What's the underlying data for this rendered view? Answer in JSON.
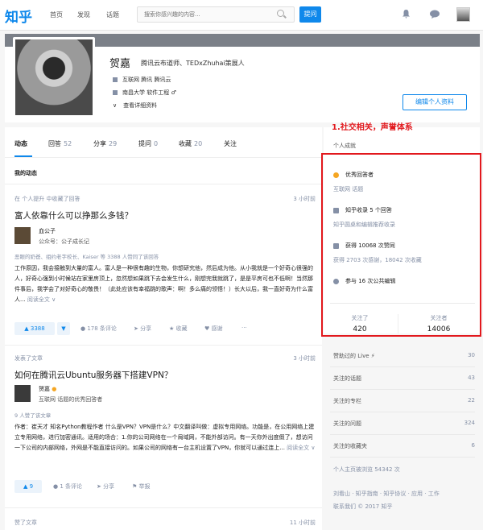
{
  "topbar": {
    "logo": "知乎",
    "nav": [
      "首页",
      "发现",
      "话题"
    ],
    "search_placeholder": "搜索你感兴趣的内容...",
    "ask_label": "提问"
  },
  "profile": {
    "name": "贺嘉",
    "headline": "腾讯云布道师、TEDxZhuhai策展人",
    "industry": "互联网 腾讯 腾讯云",
    "education": "南昌大学 软件工程 ♂",
    "more": "查看详细资料",
    "edit_label": "编辑个人资料"
  },
  "tabs": [
    {
      "label": "动态",
      "count": ""
    },
    {
      "label": "回答",
      "count": "52"
    },
    {
      "label": "分享",
      "count": "29"
    },
    {
      "label": "提问",
      "count": "0"
    },
    {
      "label": "收藏",
      "count": "20"
    },
    {
      "label": "关注",
      "count": ""
    }
  ],
  "feed": {
    "section_title": "我的动态",
    "item1": {
      "meta": "在 个人提升 中收藏了回答",
      "time": "3 小时前",
      "title": "富人依靠什么可以挣那么多钱？",
      "author": "血公子",
      "bio": "公众号：公子成长记",
      "voters": "恶眼的奶爸、组约老字校长、Kaiser 等 3388 人赞同了该回答",
      "body": "工作原因，我会接触到大量的富人。富人是一种很有趣的生物，你想研究他，然后成为他。从小我就是一个好奇心很强的人，好奇心强到小时候站在家里房顶上，忽然想如果跳下去会发生什么，刚想完我就跳了，是是平房可也不低啊！当然那件事后，我学会了对好奇心的敬畏！（此处应该有幸福跳的歌声：啊！多么痛的领悟！）长大以后，我一直好奇为什么富人...",
      "readmore": "阅读全文 ∨",
      "upvotes": "3388",
      "comments": "178 条评论",
      "share": "分享",
      "collect": "收藏",
      "thanks": "感谢",
      "more": "···"
    },
    "item2": {
      "meta": "发表了文章",
      "time": "3 小时前",
      "title": "如何在腾讯云Ubuntu服务器下搭建VPN？",
      "author": "贺嘉",
      "bio": "互联网 话题的优秀回答者",
      "voters": "9 人赞了该文章",
      "body": "作者：崔天才 知名Python教程作者 什么是VPN？VPN是什么？中文翻译叫做：虚拟专用网络。功能是，在公用网络上建立专用网络，进行加密通讯。适用的场合：1.你的公司网络在一个局域网，不能外部访问。有一天你外出度假了，想访问一下公司的内部网络，外网是不能直接访问的。如果公司的网络有一台主机设置了VPN，你就可以通过连上...",
      "readmore": "阅读全文 ∨",
      "upvotes": "9",
      "comments": "1 条评论",
      "share": "分享",
      "report": "举报"
    },
    "item3": {
      "meta": "赞了文章",
      "time": "11 小时前"
    }
  },
  "annotation": "1.社交相关，声誉体系",
  "sidebar": {
    "achievements_title": "个人成就",
    "excellent": "优秀回答者",
    "excellent_topic": "互联网 话题",
    "collected": "知乎收录 5 个回答",
    "collected_sub": "知乎圆桌和编辑推荐收录",
    "votes": "获得 10068 次赞同",
    "votes_sub": "获得 2703 次感谢，18042 次收藏",
    "edits": "参与 16 次公共编辑",
    "following_label": "关注了",
    "following_value": "420",
    "followers_label": "关注者",
    "followers_value": "14006",
    "rows": [
      {
        "label": "赞助过的 Live ⚡",
        "num": "30"
      },
      {
        "label": "关注的话题",
        "num": "43"
      },
      {
        "label": "关注的专栏",
        "num": "22"
      },
      {
        "label": "关注的问题",
        "num": "324"
      },
      {
        "label": "关注的收藏夹",
        "num": "6"
      }
    ],
    "views": "个人主页被浏览 54342 次",
    "footer1": "刘看山 · 知乎指南 · 知乎协议 · 应用 · 工作",
    "footer2": "联系我们 © 2017 知乎"
  },
  "colors": {
    "brand": "#0f88eb",
    "annotation": "#e2181d"
  }
}
